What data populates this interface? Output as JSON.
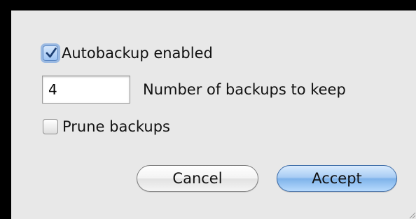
{
  "dialog": {
    "autobackup": {
      "label": "Autobackup enabled",
      "checked": true
    },
    "backups": {
      "value": "4",
      "label": "Number of backups to keep"
    },
    "prune": {
      "label": "Prune backups",
      "checked": false
    },
    "buttons": {
      "cancel_label": "Cancel",
      "accept_label": "Accept"
    }
  },
  "colors": {
    "background": "#000000",
    "panel": "#e8e8e8",
    "accent": "#7fb3ea",
    "checkmark": "#1d3f73"
  },
  "icons": {
    "check": "checkmark-icon",
    "grip": "resize-grip-icon"
  }
}
